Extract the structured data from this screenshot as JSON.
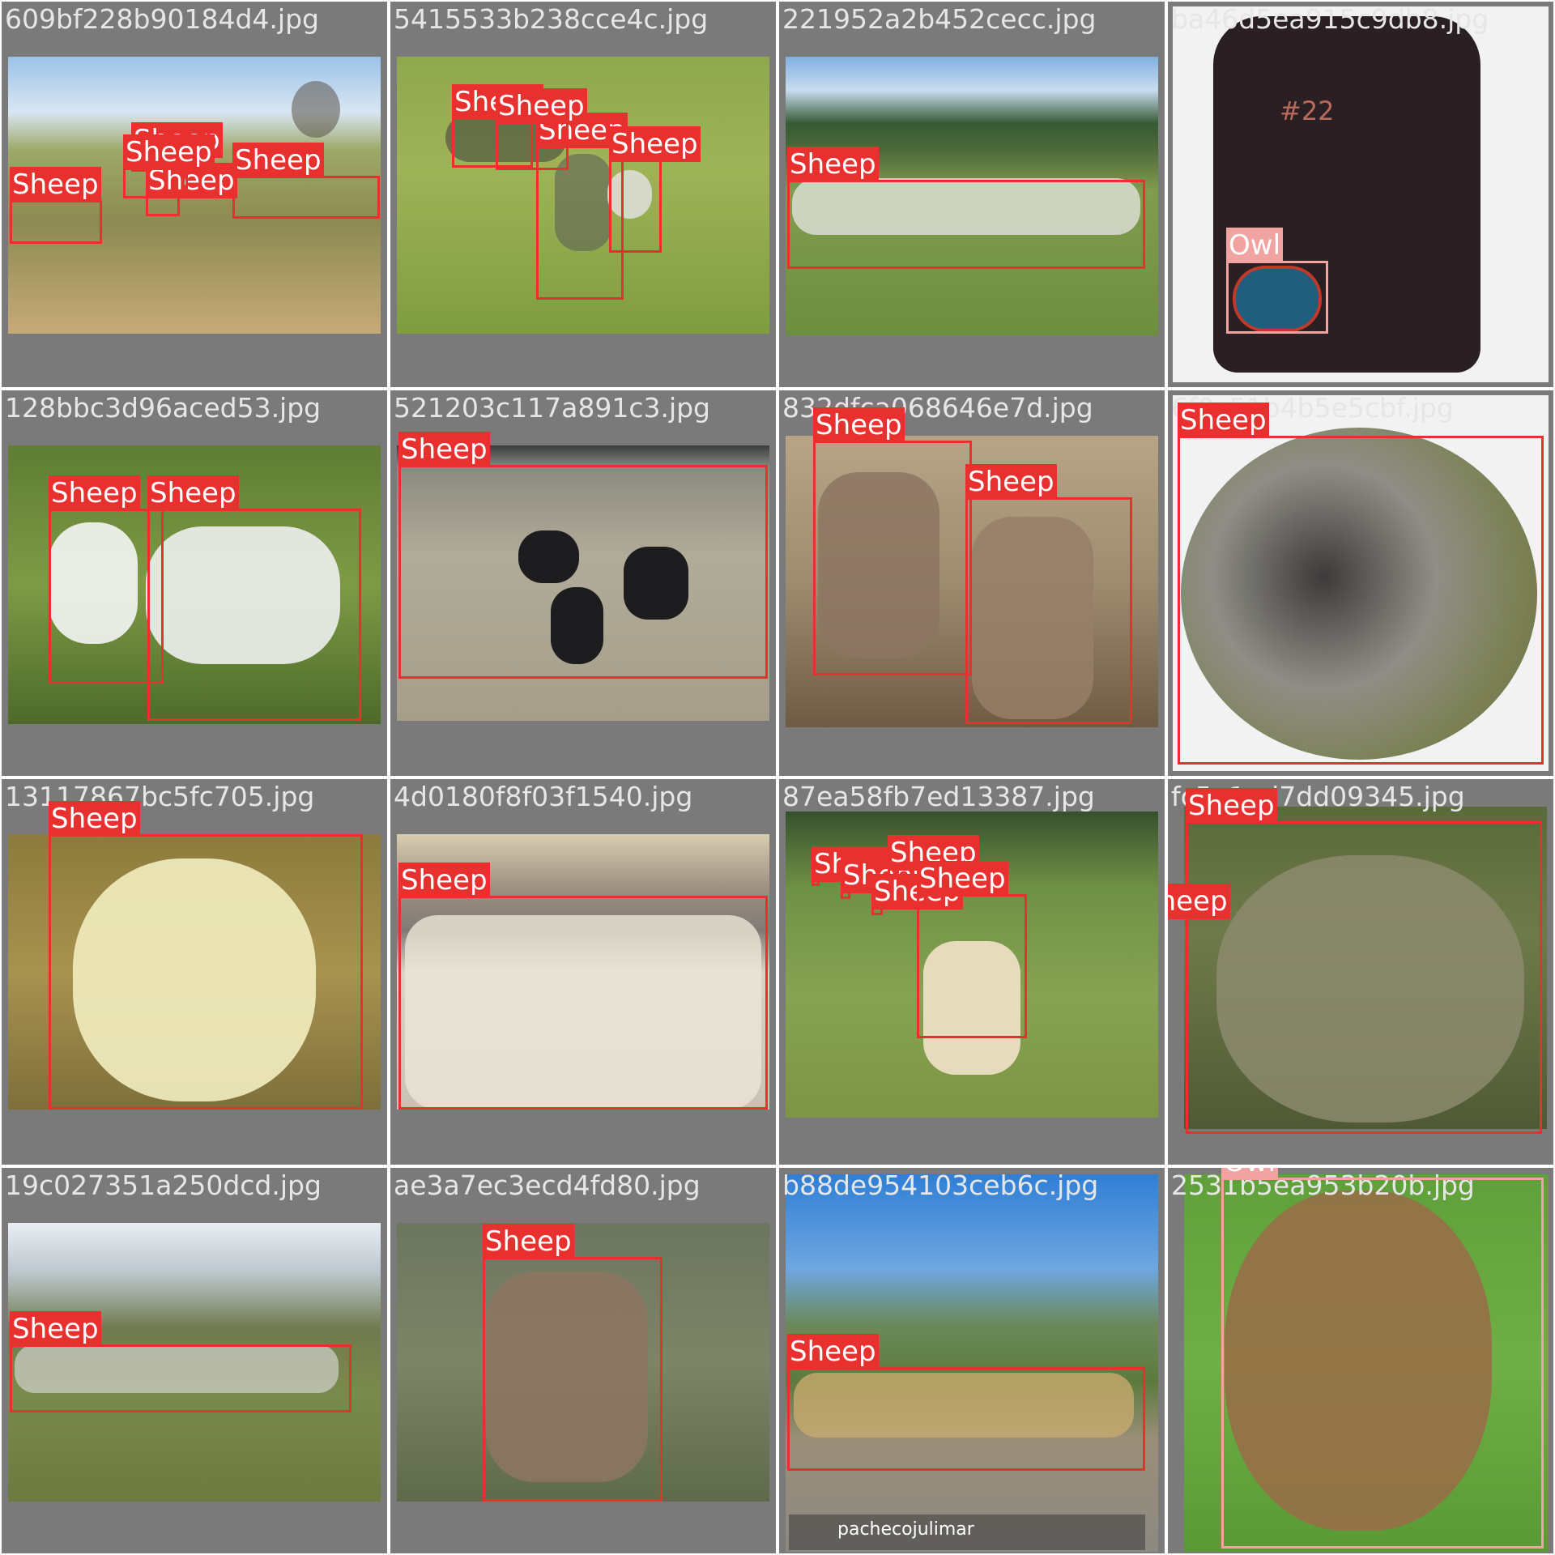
{
  "tiles": [
    {
      "filename": "609bf228b90184d4.jpg",
      "labels": [
        "Sheep",
        "Sheep",
        "Sheep",
        "Sheep",
        "Sheep"
      ]
    },
    {
      "filename": "5415533b238cce4c.jpg",
      "labels": [
        "Sheep",
        "Sheep",
        "Sheep",
        "Sheep"
      ]
    },
    {
      "filename": "221952a2b452cecc.jpg",
      "labels": [
        "Sheep"
      ]
    },
    {
      "filename": "ba46d5ea915c9db8.jpg",
      "labels": [
        "Owl"
      ],
      "tshirt_text": "#22"
    },
    {
      "filename": "128bbc3d96aced53.jpg",
      "labels": [
        "Sheep",
        "Sheep"
      ]
    },
    {
      "filename": "521203c117a891c3.jpg",
      "labels": [
        "Sheep"
      ]
    },
    {
      "filename": "832dfca068646e7d.jpg",
      "labels": [
        "Sheep",
        "Sheep"
      ]
    },
    {
      "filename": "6f0c51b4b5e5cbf.jpg",
      "labels": [
        "Sheep"
      ]
    },
    {
      "filename": "13117867bc5fc705.jpg",
      "labels": [
        "Sheep"
      ]
    },
    {
      "filename": "4d0180f8f03f1540.jpg",
      "labels": [
        "Sheep"
      ]
    },
    {
      "filename": "87ea58fb7ed13387.jpg",
      "labels": [
        "Sheep",
        "Sheep",
        "Sheep",
        "Sheep",
        "Sheep"
      ]
    },
    {
      "filename": "fc5a1ed7dd09345.jpg",
      "labels": [
        "Sheep",
        "Sheep"
      ]
    },
    {
      "filename": "19c027351a250dcd.jpg",
      "labels": [
        "Sheep"
      ]
    },
    {
      "filename": "ae3a7ec3ecd4fd80.jpg",
      "labels": [
        "Sheep"
      ]
    },
    {
      "filename": "b88de954103ceb6c.jpg",
      "labels": [
        "Sheep"
      ],
      "watermark": "pachecojulimar"
    },
    {
      "filename": "2531b5ea953b20b.jpg",
      "labels": [
        "Owl"
      ]
    }
  ],
  "colors": {
    "sheep_box": "#e8302f",
    "owl_box": "#f0a3a0",
    "tile_bg": "#7a7a7a",
    "filename_text": "#e6e6e6"
  }
}
